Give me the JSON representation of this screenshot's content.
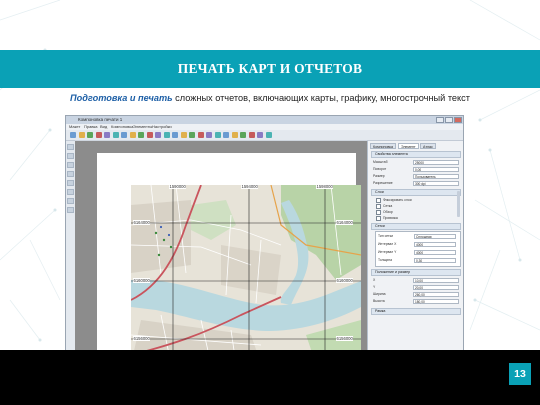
{
  "slide": {
    "title": "ПЕЧАТЬ КАРТ И ОТЧЕТОВ",
    "subtitle_highlight": "Подготовка и печать",
    "subtitle_rest": " сложных отчетов, включающих карты, графику, многострочный текст",
    "page_number": "13",
    "accent_color": "#0aa1b6"
  },
  "app": {
    "window_title": "Компоновка печати 1",
    "menu": [
      "Макет",
      "Правка",
      "Вид",
      "Компоновка",
      "Элементы",
      "Настройки"
    ],
    "toolbar_icons": [
      "new-icon",
      "open-icon",
      "save-icon",
      "print-icon",
      "export-image-icon",
      "export-pdf-icon",
      "export-svg-icon",
      "undo-icon",
      "redo-icon",
      "zoom-in-icon",
      "zoom-out-icon",
      "zoom-full-icon",
      "refresh-icon",
      "add-map-icon",
      "add-label-icon",
      "add-legend-icon",
      "add-scalebar-icon",
      "add-shape-icon",
      "add-arrow-icon",
      "add-table-icon",
      "group-icon",
      "ungroup-icon",
      "lock-icon",
      "align-icon"
    ],
    "left_tool_icons": [
      "pan-icon",
      "select-icon",
      "move-content-icon",
      "zoom-tool-icon",
      "node-tool-icon",
      "label-tool-icon",
      "legend-tool-icon",
      "scalebar-tool-icon"
    ]
  },
  "map": {
    "x_coords": [
      "1590000",
      "1594000",
      "1598000"
    ],
    "x_coords_bottom": [
      "1590000",
      "1594000",
      "1598000"
    ],
    "y_coords_left": [
      "6164000",
      "6160000",
      "6156000"
    ],
    "y_coords_right": [
      "6164000",
      "6160000",
      "6156000"
    ],
    "colors": {
      "land": "#e7e3d8",
      "water": "#b9d8df",
      "forest": "#b8d3a7",
      "road_major": "#c9545d",
      "road_minor": "#ffffff",
      "grid": "#222222"
    }
  },
  "panel": {
    "tabs": [
      "Компоновка",
      "Элемент",
      "Атлас"
    ],
    "section_main": "Свойства элемента",
    "rows": [
      {
        "label": "Масштаб",
        "value": "25000"
      },
      {
        "label": "Поворот",
        "value": "0,00"
      },
      {
        "label": "Размер",
        "value": "Пользователь"
      },
      {
        "label": "Разрешение",
        "value": "300 dpi"
      }
    ],
    "section_layers": "Слои",
    "layer_checks": [
      "Фиксировать слои",
      "Сетка",
      "Обзор",
      "Привязка"
    ],
    "section_grid": "Сетки",
    "grid_rows": [
      {
        "label": "Тип сетки",
        "value": "Сплошная"
      },
      {
        "label": "Интервал X",
        "value": "4000"
      },
      {
        "label": "Интервал Y",
        "value": "4000"
      },
      {
        "label": "Толщина",
        "value": "0,30"
      }
    ],
    "section_position": "Положение и размер",
    "position_rows": [
      {
        "label": "X",
        "value": "10,00"
      },
      {
        "label": "Y",
        "value": "20,00"
      },
      {
        "label": "Ширина",
        "value": "260,00"
      },
      {
        "label": "Высота",
        "value": "180,00"
      }
    ],
    "section_frame": "Рамка"
  }
}
